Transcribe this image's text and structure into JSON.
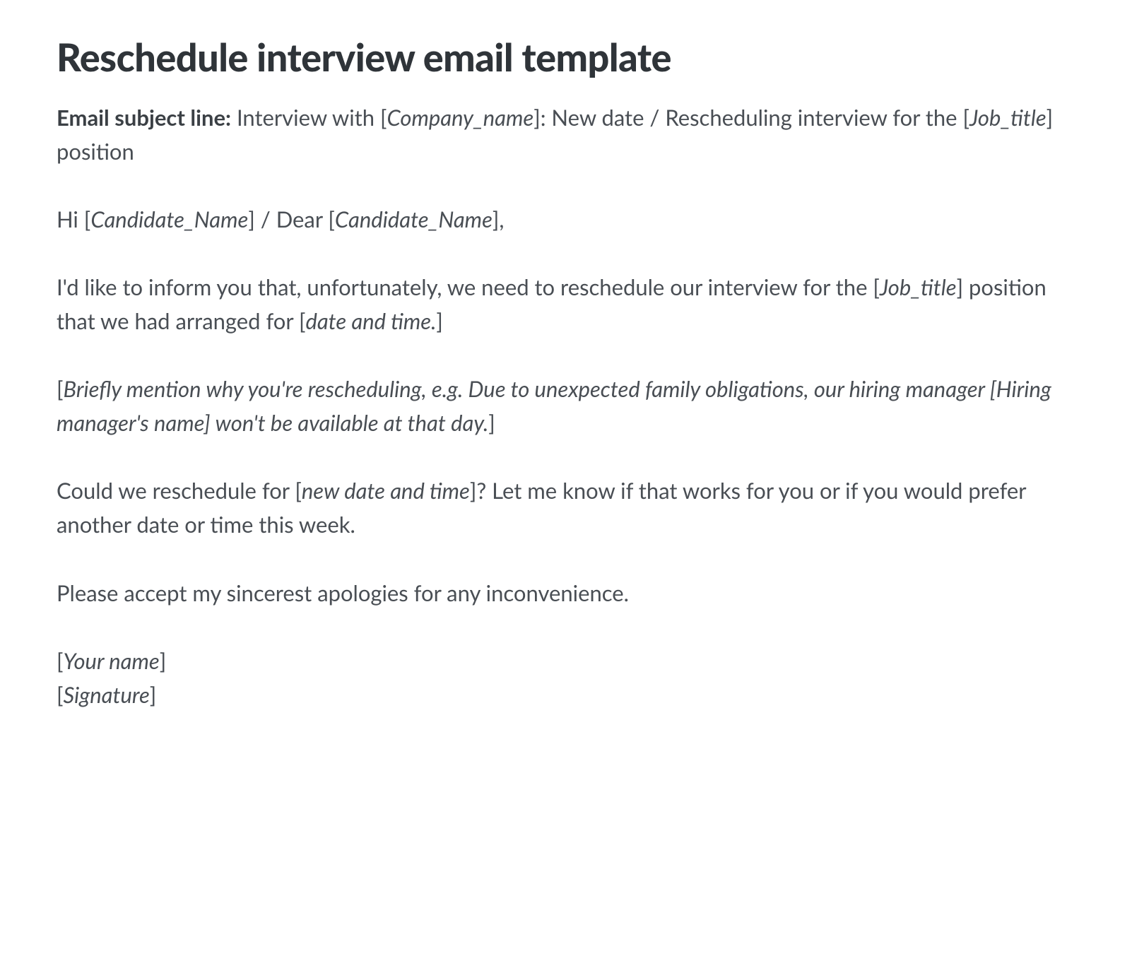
{
  "title": "Reschedule interview email template",
  "subject": {
    "label": "Email subject line:",
    "t1": " Interview with [",
    "ph_company": "Company_name",
    "t2": "]: New date / Rescheduling interview for the [",
    "ph_job": "Job_title",
    "t3": "] position"
  },
  "greeting": {
    "t1": "Hi [",
    "ph_cand1": "Candidate_Name",
    "t2": "] / Dear [",
    "ph_cand2": "Candidate_Name",
    "t3": "],"
  },
  "para1": {
    "t1": "I'd like to inform you that, unfortunately, we need to reschedule our interview for the [",
    "ph_job": "Job_title",
    "t2": "] position that we had arranged for [",
    "ph_date": "date and time.",
    "t3": "]"
  },
  "reason": {
    "t1": "[",
    "body": "Briefly mention why you're rescheduling, e.g. Due to unexpected family obligations, our hiring manager [Hiring manager's name] won't be available at that day.",
    "t3": "]"
  },
  "para2": {
    "t1": "Could we reschedule for [",
    "ph_newdate": "new date and time",
    "t2": "]? Let me know if that works for you or if you would prefer another date or time this week."
  },
  "apology": "Please accept my sincerest apologies for any inconvenience.",
  "signoff": {
    "l1a": "[",
    "l1b": "Your name",
    "l1c": "]",
    "l2a": "[",
    "l2b": "Signature",
    "l2c": "]"
  }
}
